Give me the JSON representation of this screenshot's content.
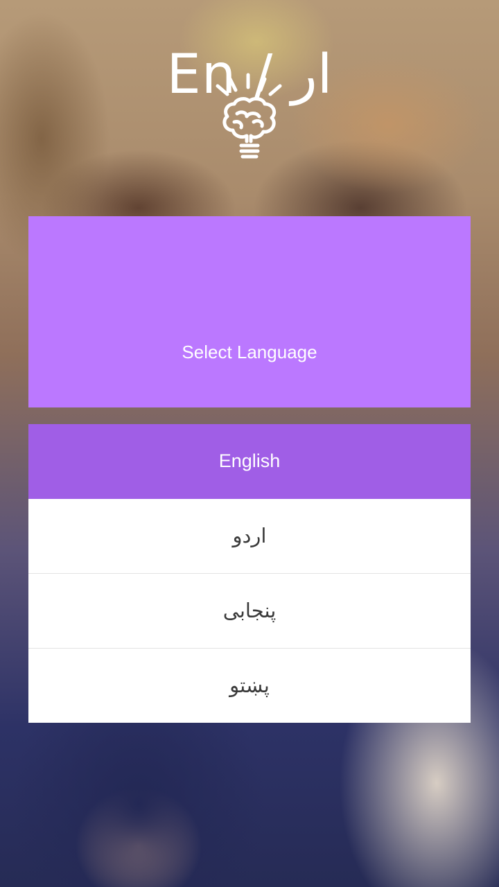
{
  "header": {
    "logo_icon": "brain-lightbulb-icon",
    "title": "En / ار",
    "subtitle": "Select Language"
  },
  "languages": [
    {
      "label": "English",
      "selected": true
    },
    {
      "label": "اردو",
      "selected": false
    },
    {
      "label": "پنجابی",
      "selected": false
    },
    {
      "label": "پښتو",
      "selected": false
    }
  ],
  "colors": {
    "card_background": "#bb78ff",
    "selected_item": "#a05ee6",
    "item_background": "#ffffff",
    "item_text": "#3a3a3a"
  }
}
